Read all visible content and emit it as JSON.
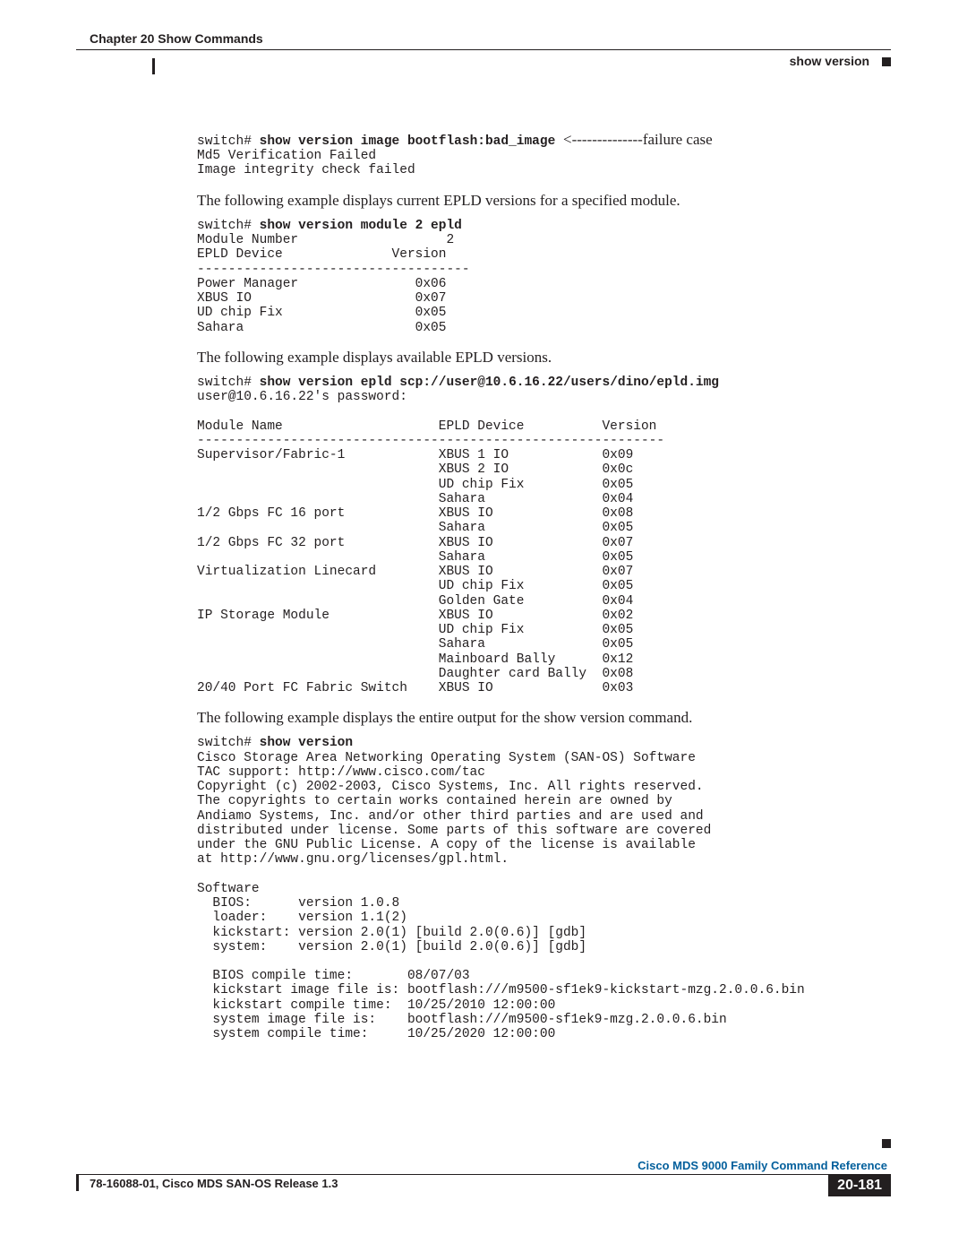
{
  "header": {
    "chapter": "Chapter 20    Show Commands",
    "section": "show version"
  },
  "block1": {
    "prompt": "switch# ",
    "cmd": "show version image bootflash:bad_image ",
    "note": "<--------------failure case",
    "out": "Md5 Verification Failed\nImage integrity check failed"
  },
  "para1": "The following example displays current EPLD versions for a specified module.",
  "block2": {
    "prompt": "switch# ",
    "cmd": "show version module 2 epld",
    "out": "Module Number                   2\nEPLD Device              Version\n-----------------------------------\nPower Manager               0x06\nXBUS IO                     0x07\nUD chip Fix                 0x05\nSahara                      0x05"
  },
  "para2": "The following example displays available EPLD versions.",
  "block3": {
    "prompt": "switch# ",
    "cmd": "show version epld scp://user@10.6.16.22/users/dino/epld.img",
    "out": "user@10.6.16.22's password:\n\nModule Name                    EPLD Device          Version\n------------------------------------------------------------\nSupervisor/Fabric-1            XBUS 1 IO            0x09\n                               XBUS 2 IO            0x0c\n                               UD chip Fix          0x05\n                               Sahara               0x04\n1/2 Gbps FC 16 port            XBUS IO              0x08\n                               Sahara               0x05\n1/2 Gbps FC 32 port            XBUS IO              0x07\n                               Sahara               0x05\nVirtualization Linecard        XBUS IO              0x07\n                               UD chip Fix          0x05\n                               Golden Gate          0x04\nIP Storage Module              XBUS IO              0x02\n                               UD chip Fix          0x05\n                               Sahara               0x05\n                               Mainboard Bally      0x12\n                               Daughter card Bally  0x08\n20/40 Port FC Fabric Switch    XBUS IO              0x03"
  },
  "para3": "The following example displays the entire output for the show version command.",
  "block4": {
    "prompt": "switch# ",
    "cmd": "show version",
    "out": "Cisco Storage Area Networking Operating System (SAN-OS) Software\nTAC support: http://www.cisco.com/tac\nCopyright (c) 2002-2003, Cisco Systems, Inc. All rights reserved.\nThe copyrights to certain works contained herein are owned by\nAndiamo Systems, Inc. and/or other third parties and are used and\ndistributed under license. Some parts of this software are covered\nunder the GNU Public License. A copy of the license is available\nat http://www.gnu.org/licenses/gpl.html.\n\nSoftware\n  BIOS:      version 1.0.8\n  loader:    version 1.1(2)\n  kickstart: version 2.0(1) [build 2.0(0.6)] [gdb]\n  system:    version 2.0(1) [build 2.0(0.6)] [gdb]\n\n  BIOS compile time:       08/07/03\n  kickstart image file is: bootflash:///m9500-sf1ek9-kickstart-mzg.2.0.0.6.bin\n  kickstart compile time:  10/25/2010 12:00:00\n  system image file is:    bootflash:///m9500-sf1ek9-mzg.2.0.0.6.bin\n  system compile time:     10/25/2020 12:00:00"
  },
  "footer": {
    "ref": "Cisco MDS 9000 Family Command Reference",
    "doc": "78-16088-01, Cisco MDS SAN-OS Release 1.3",
    "page": "20-181"
  }
}
